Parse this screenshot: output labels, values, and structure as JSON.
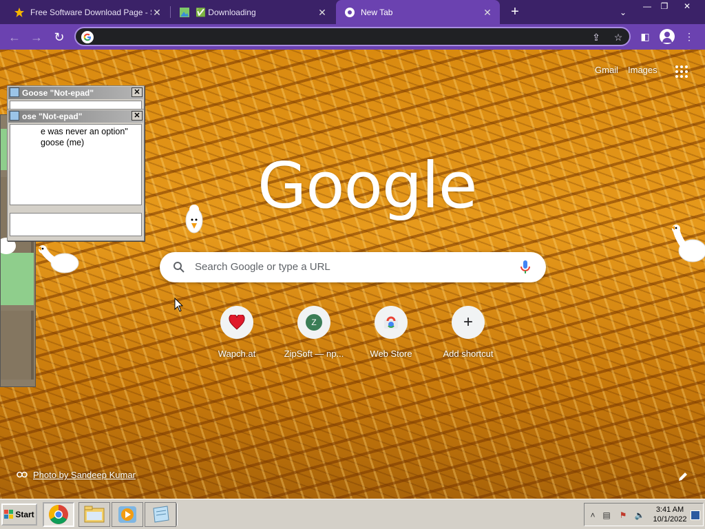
{
  "browser": {
    "tabs": [
      {
        "label": "Free Software Download Page - Soft",
        "icon": "star-icon",
        "active": false
      },
      {
        "label": "✅ Downloading",
        "icon": "image-icon",
        "active": false
      },
      {
        "label": "New Tab",
        "icon": "chrome-icon",
        "active": true
      }
    ],
    "new_tab_label": "+",
    "omnibox": {
      "value": "",
      "placeholder": ""
    }
  },
  "ntp": {
    "top_links": {
      "gmail": "Gmail",
      "images": "Images"
    },
    "logo": "Google",
    "search_placeholder": "Search Google or type a URL",
    "shortcuts": [
      {
        "label": "Wapch.at",
        "icon": "heart-icon"
      },
      {
        "label": "ZipSoft — np...",
        "icon": "letter-z-icon",
        "letter": "Z"
      },
      {
        "label": "Web Store",
        "icon": "web-store-icon"
      },
      {
        "label": "Add shortcut",
        "icon": "plus-icon",
        "symbol": "+"
      }
    ],
    "photo_credit": "Photo by Sandeep Kumar"
  },
  "goose_notepads": [
    {
      "title": "Goose \"Not-epad\"",
      "text": ""
    },
    {
      "title": "ose \"Not-epad\"",
      "text": "e was never an option\"\ngoose (me)"
    }
  ],
  "taskbar": {
    "start_label": "Start",
    "clock_time": "3:41 AM",
    "clock_date": "10/1/2022"
  },
  "colors": {
    "tabstrip": "#3b2268",
    "toolbar": "#6b42b0",
    "background_accent": "#e79a1c"
  }
}
